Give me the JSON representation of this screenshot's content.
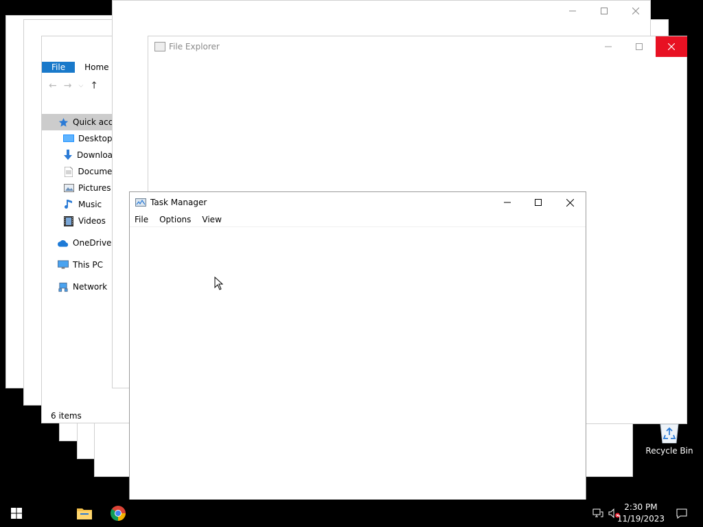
{
  "explorer_back": {
    "tabs": [
      "File",
      "Home"
    ],
    "sidebar": [
      {
        "label": "Quick acce",
        "icon": "star-icon",
        "selected": true
      },
      {
        "label": "Desktop",
        "icon": "desktop-icon"
      },
      {
        "label": "Download",
        "icon": "download-icon"
      },
      {
        "label": "Documen",
        "icon": "document-icon"
      },
      {
        "label": "Pictures",
        "icon": "pictures-icon"
      },
      {
        "label": "Music",
        "icon": "music-icon"
      },
      {
        "label": "Videos",
        "icon": "video-icon"
      },
      {
        "label": "OneDrive",
        "icon": "cloud-icon"
      },
      {
        "label": "This PC",
        "icon": "computer-icon"
      },
      {
        "label": "Network",
        "icon": "network-icon"
      }
    ],
    "status": "6 items"
  },
  "file_explorer": {
    "title": "File Explorer"
  },
  "task_manager": {
    "title": "Task Manager",
    "menu": [
      "File",
      "Options",
      "View"
    ]
  },
  "desktop": {
    "recycle_bin": "Recycle Bin"
  },
  "taskbar": {
    "time": "2:30 PM",
    "date": "11/19/2023"
  },
  "colors": {
    "close_hover": "#e81123",
    "ribbon_file": "#1979ca",
    "selection": "#cccccc"
  }
}
